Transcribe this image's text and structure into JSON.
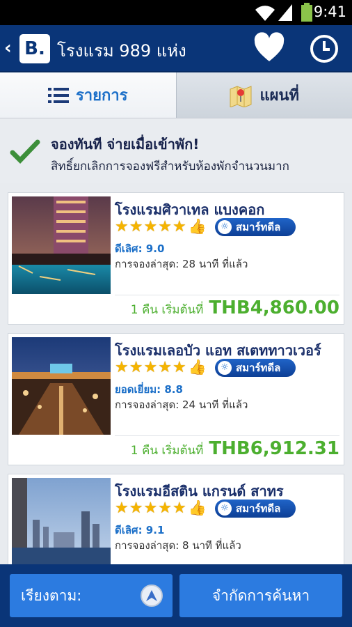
{
  "status": {
    "time": "9:41"
  },
  "appbar": {
    "back": "‹",
    "logo": "B.",
    "title": "โรงแรม 989 แห่ง",
    "icons": [
      "heart-icon",
      "clock-icon"
    ]
  },
  "tabs": [
    {
      "label": "รายการ",
      "icon": "list-icon",
      "active": true
    },
    {
      "label": "แผนที่",
      "icon": "map-icon",
      "active": false
    }
  ],
  "banner": {
    "title": "จองทันที จ่ายเมื่อเข้าพัก!",
    "subtitle": "สิทธิ์ยกเลิกการจองฟรีสำหรับห้องพักจำนวนมาก"
  },
  "hotels": [
    {
      "name": "โรงแรมศิวาเทล แบงคอก",
      "stars": 5,
      "badge": "สมาร์ทดีล",
      "score": "ดีเลิศ: 9.0",
      "last_booked": "การจองล่าสุด: 28 นาที ที่แล้ว",
      "price_prefix": "1 คืน เริ่มต้นที่",
      "price": "THB4,860.00"
    },
    {
      "name": "โรงแรมเลอบัว แอท สเตททาวเวอร์",
      "stars": 5,
      "badge": "สมาร์ทดีล",
      "score": "ยอดเยี่ยม: 8.8",
      "last_booked": "การจองล่าสุด: 24 นาที ที่แล้ว",
      "price_prefix": "1 คืน เริ่มต้นที่",
      "price": "THB6,912.31"
    },
    {
      "name": "โรงแรมอีสติน แกรนด์ สาทร",
      "stars": 5,
      "badge": "สมาร์ทดีล",
      "score": "ดีเลิศ: 9.1",
      "last_booked": "การจองล่าสุด: 8 นาที ที่แล้ว",
      "price_prefix": "",
      "price": ""
    }
  ],
  "bottom": {
    "sort_label": "เรียงตาม:",
    "filter_label": "จำกัดการค้นหา"
  },
  "colors": {
    "primary": "#0a3578",
    "accent": "#2c7be0",
    "price": "#4caf2f",
    "star": "#f5b400"
  }
}
